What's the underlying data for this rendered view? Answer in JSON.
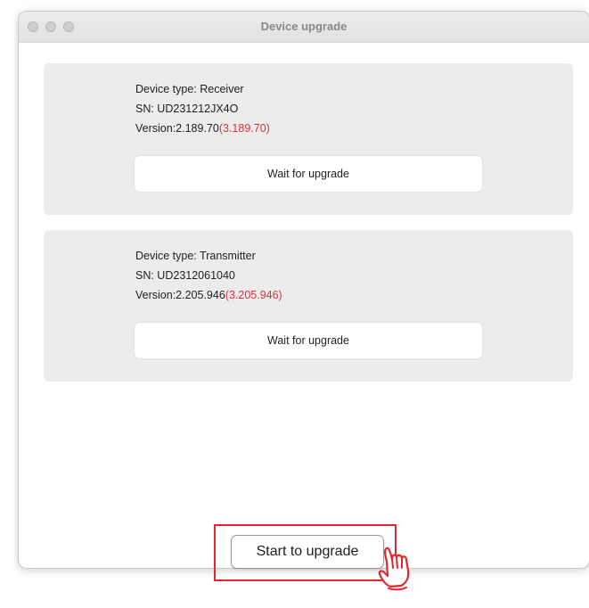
{
  "window": {
    "title": "Device upgrade"
  },
  "devices": [
    {
      "type_line": "Device type: Receiver",
      "sn_line": "SN:  UD231212JX4O",
      "version_prefix": "Version:2.189.70",
      "version_new": "(3.189.70)",
      "button_label": "Wait for upgrade"
    },
    {
      "type_line": "Device type: Transmitter",
      "sn_line": "SN:  UD2312061040",
      "version_prefix": "Version:2.205.946",
      "version_new": "(3.205.946)",
      "button_label": "Wait for upgrade"
    }
  ],
  "footer": {
    "start_label": "Start to upgrade"
  },
  "colors": {
    "new_version": "#e0303f",
    "highlight": "#e3262f",
    "card_bg": "#ececec"
  },
  "icons": {
    "pointer": "pointing-hand-icon"
  }
}
